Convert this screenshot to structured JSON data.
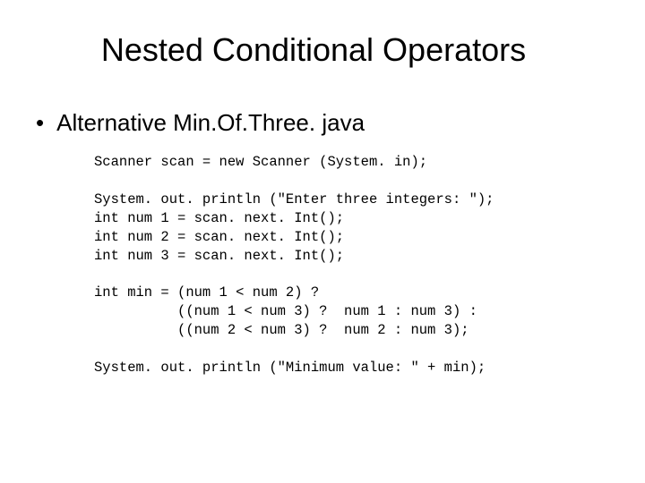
{
  "title": "Nested Conditional Operators",
  "subtitle": "Alternative Min.Of.Three. java",
  "code": "Scanner scan = new Scanner (System. in);\n\nSystem. out. println (\"Enter three integers: \");\nint num 1 = scan. next. Int();\nint num 2 = scan. next. Int();\nint num 3 = scan. next. Int();\n\nint min = (num 1 < num 2) ?\n          ((num 1 < num 3) ?  num 1 : num 3) :\n          ((num 2 < num 3) ?  num 2 : num 3);\n\nSystem. out. println (\"Minimum value: \" + min);"
}
